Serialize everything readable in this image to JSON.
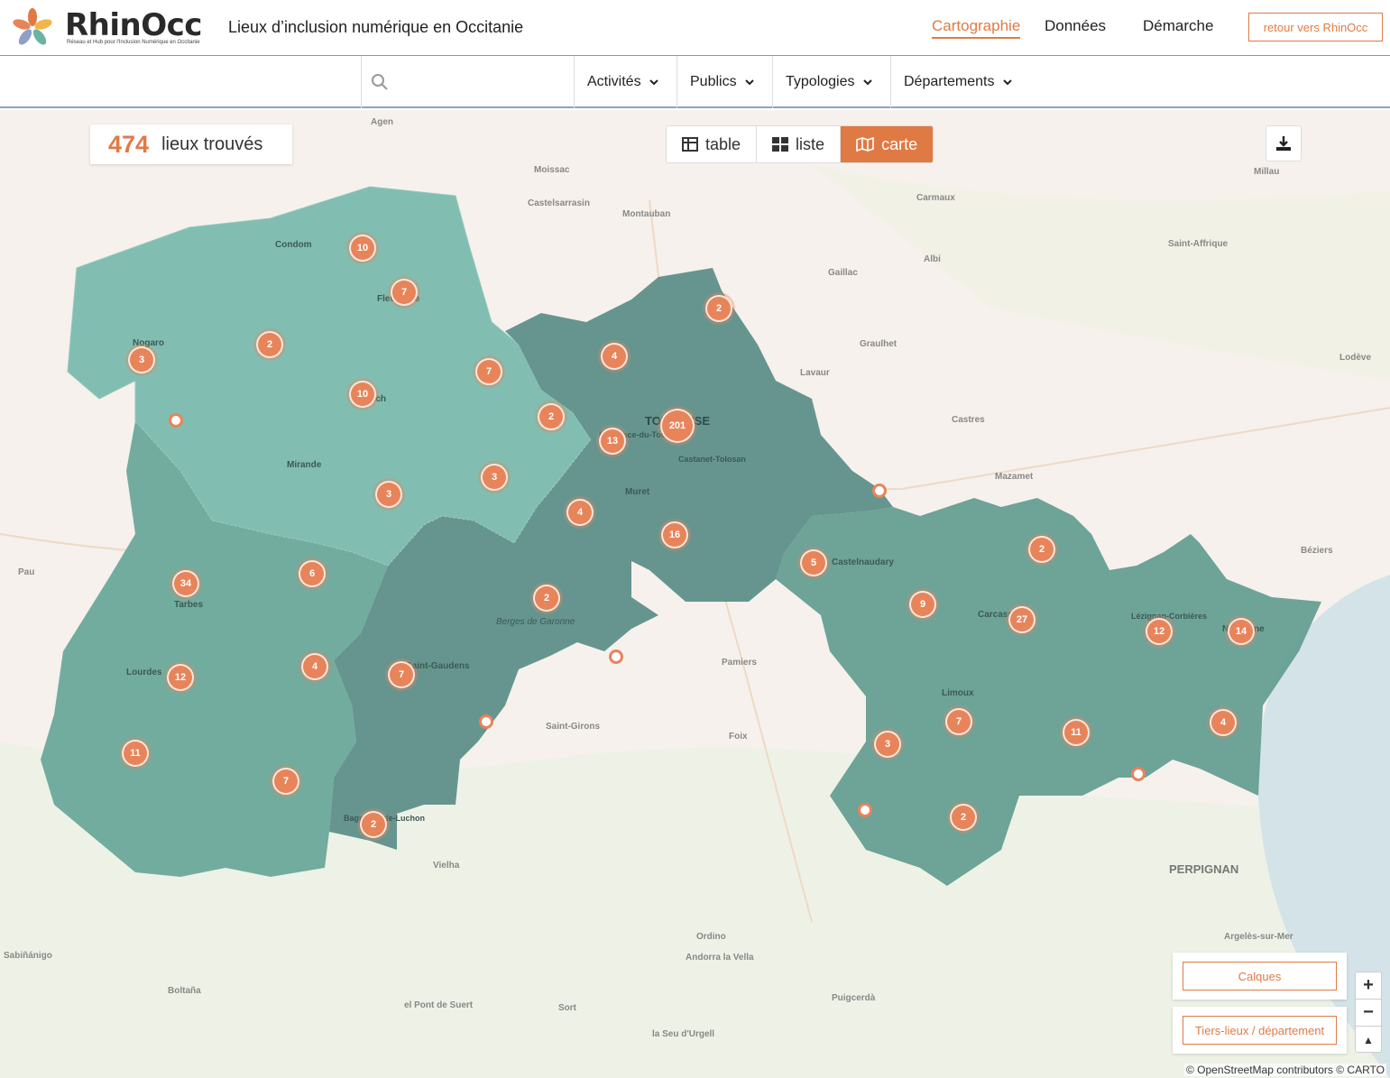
{
  "header": {
    "brand": "RhinOcc",
    "brand_sub": "Réseau et Hub pour l'Inclusion Numérique en Occitanie",
    "site_title": "Lieux d’inclusion numérique en Occitanie",
    "nav": [
      "Cartographie",
      "Données",
      "Démarche"
    ],
    "active_nav": "Cartographie",
    "back_button": "retour vers RhinOcc",
    "accent_color": "#e07a45"
  },
  "filters": {
    "search_placeholder": "",
    "items": [
      "Activités",
      "Publics",
      "Typologies",
      "Départements"
    ]
  },
  "results": {
    "count": "474",
    "label": "lieux trouvés"
  },
  "views": {
    "table": "table",
    "list": "liste",
    "map": "carte",
    "active": "carte"
  },
  "map": {
    "clusters": [
      "10",
      "7",
      "2",
      "3",
      "10",
      "7",
      "2",
      "3",
      "3",
      "2",
      "4",
      "201",
      "13",
      "4",
      "16",
      "2",
      "34",
      "6",
      "4",
      "12",
      "7",
      "11",
      "7",
      "2",
      "5",
      "2",
      "9",
      "27",
      "12",
      "14",
      "7",
      "11",
      "4",
      "3",
      "2"
    ],
    "places": [
      "Agen",
      "Moissac",
      "Castelsarrasin",
      "Montauban",
      "Millau",
      "Carmaux",
      "Condom",
      "Fleurance",
      "Nogaro",
      "Auch",
      "Mirande",
      "Albi",
      "Gaillac",
      "Saint-Affrique",
      "Graulhet",
      "Lavaur",
      "Lodève",
      "Castres",
      "Mazamet",
      "TOULOUSE",
      "Plaisance-du-Touch",
      "Castanet-Tolosan",
      "Muret",
      "Pau",
      "Tarbes",
      "Castelnaudary",
      "Béziers",
      "Carcassonne",
      "Lézignan-Corbières",
      "Narbonne",
      "Berges de Garonne",
      "Saint-Gaudens",
      "Lourdes",
      "Pamiers",
      "Saint-Girons",
      "Foix",
      "Limoux",
      "Bagnères-de-Luchon",
      "Vielha",
      "PERPIGNAN",
      "Argelès-sur-Mer",
      "Sabiñánigo",
      "Ordino",
      "Andorra la Vella",
      "Boltaña",
      "el Pont de Suert",
      "Sort",
      "Puigcerdà",
      "la Seu d'Urgell"
    ],
    "fill_colors": [
      "#7bbcae",
      "#6aa89a",
      "#5e8f8a",
      "#669e94"
    ]
  },
  "controls": {
    "layers_button": "Calques",
    "tiers_button": "Tiers-lieux / département",
    "zoom_in": "+",
    "zoom_out": "−",
    "reset_north": "▲"
  },
  "attribution": "© OpenStreetMap contributors © CARTO"
}
